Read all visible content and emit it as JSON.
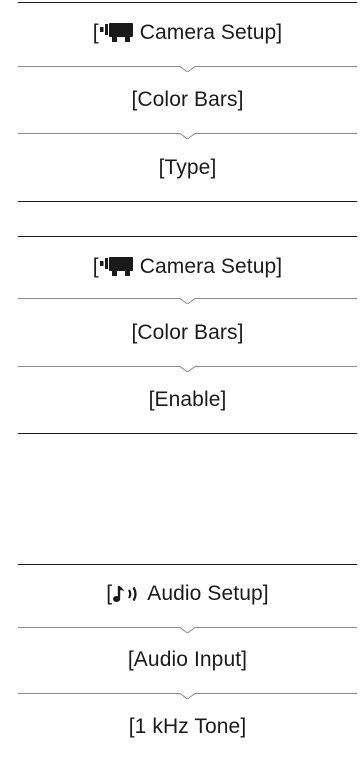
{
  "procedures": [
    {
      "steps": [
        {
          "prefix": "[",
          "icon": "camera-icon",
          "text": "Camera Setup]"
        },
        {
          "text": "[Color Bars]"
        },
        {
          "text": "[Type]"
        }
      ]
    },
    {
      "steps": [
        {
          "prefix": "[",
          "icon": "camera-icon",
          "text": "Camera Setup]"
        },
        {
          "text": "[Color Bars]"
        },
        {
          "text": "[Enable]"
        }
      ]
    },
    {
      "steps": [
        {
          "prefix": "[",
          "icon": "audio-icon",
          "text": "Audio Setup]"
        },
        {
          "text": "[Audio Input]"
        },
        {
          "text": "[1 kHz Tone]"
        }
      ]
    }
  ],
  "colors": {
    "text": "#1a1a1a",
    "rule": "#1a1a1a",
    "separator": "#8a8a8a"
  }
}
